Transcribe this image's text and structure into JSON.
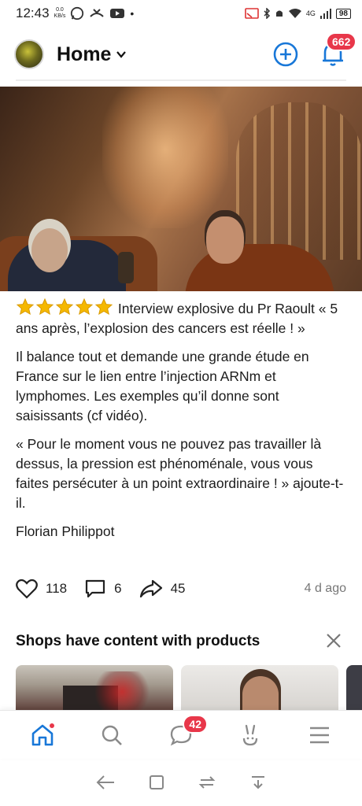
{
  "status_bar": {
    "time": "12:43",
    "speed_value": "0.0",
    "speed_unit": "KB/s",
    "signal_label": "4G",
    "battery": "98"
  },
  "header": {
    "title": "Home",
    "notification_count": "662"
  },
  "post": {
    "title": "Interview explosive du Pr Raoult « 5 ans après, l’explosion des cancers est réelle ! »",
    "rating_stars": 5,
    "body_1": "Il balance tout et demande une grande étude en France sur le lien entre l’injection ARNm et lymphomes. Les exemples qu’il donne sont saisissants (cf vidéo).",
    "body_2": "« Pour le moment vous ne pouvez pas travailler là dessus, la pression est phénoménale, vous vous faites persécuter à un point extraordinaire ! » ajoute-t-il.",
    "author": "Florian Philippot",
    "likes": "118",
    "comments": "6",
    "shares": "45",
    "time_ago": "4 d ago"
  },
  "shops": {
    "title": "Shops have content with products"
  },
  "bottom_nav": {
    "messages_badge": "42"
  },
  "colors": {
    "accent": "#1877d8",
    "badge": "#e8374a",
    "star": "#f5b800"
  }
}
